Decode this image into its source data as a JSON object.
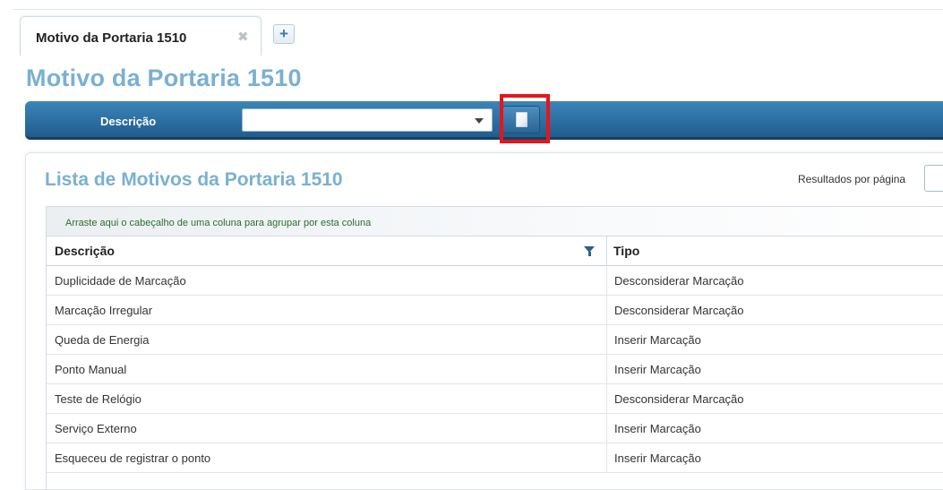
{
  "tab": {
    "label": "Motivo da Portaria 1510",
    "close_icon": "close-icon",
    "add_icon": "plus-icon",
    "add_glyph": "+",
    "close_glyph": "✖"
  },
  "page": {
    "title": "Motivo da Portaria 1510"
  },
  "filter": {
    "label": "Descrição",
    "selected_value": "",
    "button_icon": "document-icon"
  },
  "list": {
    "title": "Lista de Motivos da Portaria 1510",
    "results_per_page_label": "Resultados por página",
    "group_hint": "Arraste aqui o cabeçalho de uma coluna para agrupar por esta coluna",
    "columns": [
      "Descrição",
      "Tipo"
    ],
    "rows": [
      {
        "descricao": "Duplicidade de Marcação",
        "tipo": "Desconsiderar Marcação"
      },
      {
        "descricao": "Marcação Irregular",
        "tipo": "Desconsiderar Marcação"
      },
      {
        "descricao": "Queda de Energia",
        "tipo": "Inserir Marcação"
      },
      {
        "descricao": "Ponto Manual",
        "tipo": "Inserir Marcação"
      },
      {
        "descricao": "Teste de Relógio",
        "tipo": "Desconsiderar Marcação"
      },
      {
        "descricao": "Serviço Externo",
        "tipo": "Inserir Marcação"
      },
      {
        "descricao": "Esqueceu de registrar o ponto",
        "tipo": "Inserir Marcação"
      }
    ]
  },
  "colors": {
    "accent": "#7ab0d2",
    "toolbar": "#2c6fa3",
    "highlight": "#e8141a",
    "hint_text": "#2d6e2d"
  }
}
